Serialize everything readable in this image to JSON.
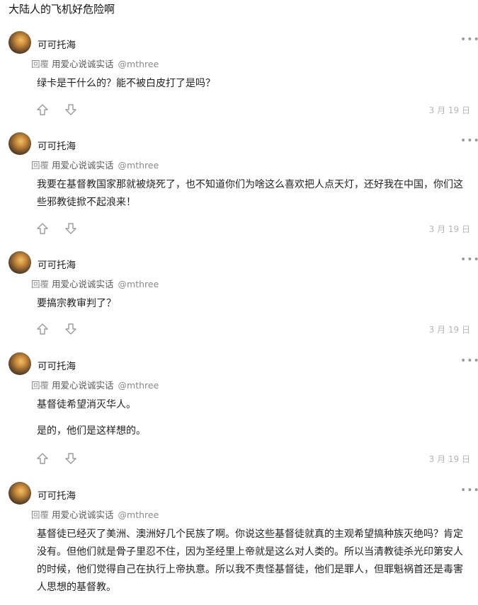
{
  "page": {
    "title": "大陆人的飞机好危险啊"
  },
  "comments": [
    {
      "author": "可可托海",
      "reply_prefix": "回覆",
      "reply_to_name": "用爱心说诚实话",
      "reply_to_handle": "@mthree",
      "paragraphs": [
        "绿卡是干什么的？能不被白皮打了是吗？"
      ],
      "date": "3 月 19 日"
    },
    {
      "author": "可可托海",
      "reply_prefix": "回覆",
      "reply_to_name": "用爱心说诚实话",
      "reply_to_handle": "@mthree",
      "paragraphs": [
        "我要在基督教国家那就被烧死了，也不知道你们为啥这么喜欢把人点天灯，还好我在中国，你们这些邪教徒掀不起浪来！"
      ],
      "date": "3 月 19 日"
    },
    {
      "author": "可可托海",
      "reply_prefix": "回覆",
      "reply_to_name": "用爱心说诚实话",
      "reply_to_handle": "@mthree",
      "paragraphs": [
        "要搞宗教审判了？"
      ],
      "date": "3 月 19 日"
    },
    {
      "author": "可可托海",
      "reply_prefix": "回覆",
      "reply_to_name": "用爱心说诚实话",
      "reply_to_handle": "@mthree",
      "paragraphs": [
        "基督徒希望消灭华人。",
        "是的，他们是这样想的。"
      ],
      "date": "3 月 19 日"
    },
    {
      "author": "可可托海",
      "reply_prefix": "回覆",
      "reply_to_name": "用爱心说诚实话",
      "reply_to_handle": "@mthree",
      "paragraphs": [
        "基督徒已经灭了美洲、澳洲好几个民族了啊。你说这些基督徒就真的主观希望搞种族灭绝吗？肯定没有。但他们就是骨子里忍不住，因为圣经里上帝就是这么对人类的。所以当清教徒杀光印第安人的时候，他们觉得自己在执行上帝执意。所以我不责怪基督徒，他们是罪人，但罪魁祸首还是毒害人思想的基督教。"
      ],
      "date": ""
    }
  ],
  "icons": {
    "more": "more-dots-icon",
    "upvote": "thumb-up-icon",
    "downvote": "thumb-down-icon"
  },
  "colors": {
    "muted": "#8a8a8a",
    "date": "#b5b5b5",
    "text": "#222222"
  }
}
